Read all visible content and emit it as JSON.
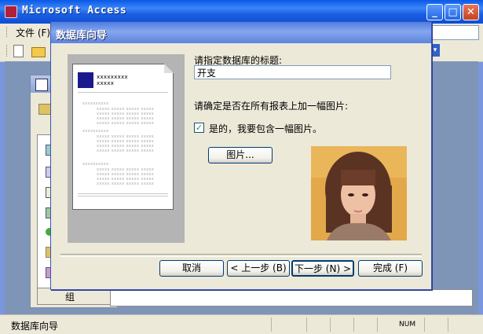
{
  "app": {
    "title": "Microsoft Access",
    "icon": "access-key-icon"
  },
  "menu": {
    "file": "文件 (F)"
  },
  "statusbar": {
    "text": "数据库向导",
    "num": "NUM"
  },
  "db_window": {
    "group_label": "组"
  },
  "wizard": {
    "title": "数据库向导",
    "preview": {
      "header_line1": "xxxxxxxxx",
      "header_line2": "xxxxx"
    },
    "title_prompt": "请指定数据库的标题:",
    "title_value": "开支",
    "picture_question": "请确定是否在所有报表上加一幅图片:",
    "include_picture_label": "是的，我要包含一幅图片。",
    "include_picture_checked": true,
    "picture_button": "图片...",
    "buttons": {
      "cancel": "取消",
      "back": "< 上一步 (B)",
      "next": "下一步 (N) >",
      "finish": "完成 (F)"
    }
  },
  "colors": {
    "titlebar": "#0a58e8",
    "dialog_bg": "#ece9d8",
    "workspace": "#7f95b8",
    "logo": "#1a1a8c"
  }
}
